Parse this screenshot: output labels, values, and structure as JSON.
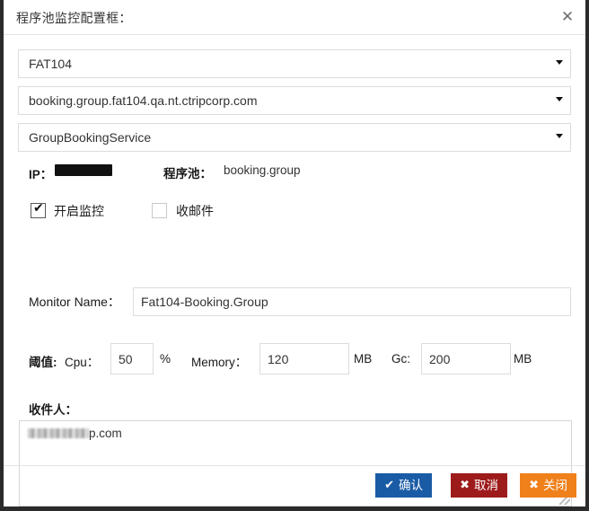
{
  "dialog": {
    "title": "程序池监控配置框：",
    "close_icon": "close-icon",
    "close_glyph": "✕"
  },
  "selects": [
    {
      "name": "environment-select",
      "value": "FAT104"
    },
    {
      "name": "host-select",
      "value": "booking.group.fat104.qa.nt.ctripcorp.com"
    },
    {
      "name": "service-select",
      "value": "GroupBookingService"
    }
  ],
  "info": {
    "ip_label": "IP：",
    "ip_value": "",
    "pool_label": "程序池：",
    "pool_value": "booking.group"
  },
  "checkboxes": [
    {
      "label": "开启监控",
      "checked": true,
      "tick": "✔"
    },
    {
      "label": "收邮件",
      "checked": false,
      "tick": ""
    }
  ],
  "monitor_name": {
    "label": "Monitor Name：",
    "value": "Fat104-Booking.Group"
  },
  "threshold": {
    "title": "阈值:",
    "cpu_label": "Cpu：",
    "cpu_value": "50",
    "cpu_unit": "%",
    "memory_label": "Memory：",
    "memory_value": "120",
    "memory_unit": "MB",
    "gc_label": "Gc:",
    "gc_value": "200",
    "gc_unit": "MB"
  },
  "recipients": {
    "label": "收件人：",
    "value_suffix": "p.com"
  },
  "footer": {
    "ok_label": "确认",
    "ok_glyph": "✔",
    "cancel_label": "取消",
    "cancel_glyph": "✖",
    "close_label": "关闭",
    "close_glyph": "✖"
  },
  "colors": {
    "ok": "#1a5ba6",
    "cancel": "#9e1b1b",
    "close": "#f0801a"
  }
}
